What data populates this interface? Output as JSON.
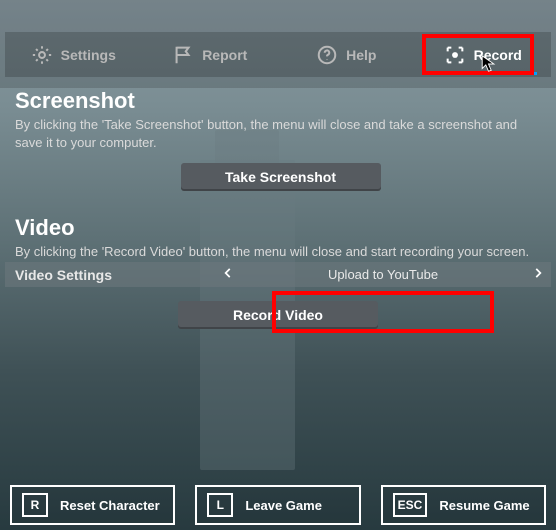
{
  "tabs": {
    "settings": "Settings",
    "report": "Report",
    "help": "Help",
    "record": "Record"
  },
  "screenshot": {
    "title": "Screenshot",
    "desc": "By clicking the 'Take Screenshot' button, the menu will close and take a screenshot and save it to your computer.",
    "button": "Take Screenshot"
  },
  "video": {
    "title": "Video",
    "desc": "By clicking the 'Record Video' button, the menu will close and start recording your screen.",
    "settings_label": "Video Settings",
    "settings_value": "Upload to YouTube",
    "button": "Record Video"
  },
  "bottom": {
    "reset_key": "R",
    "reset_label": "Reset Character",
    "leave_key": "L",
    "leave_label": "Leave Game",
    "resume_key": "ESC",
    "resume_label": "Resume Game"
  },
  "colors": {
    "highlight": "#ff0000",
    "accent": "#00a2ff"
  }
}
